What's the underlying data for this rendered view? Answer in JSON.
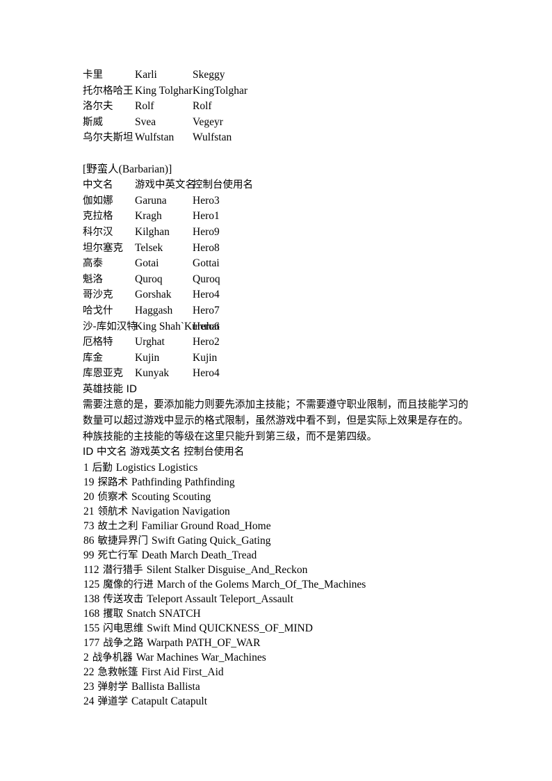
{
  "document": {
    "background_color": "#ffffff",
    "text_color": "#000000"
  },
  "viking_roster_tail": {
    "rows": [
      {
        "chinese": "卡里",
        "game_english": "Karli",
        "console_name": "Skeggy"
      },
      {
        "chinese": "托尔格哈王",
        "game_english": "King Tolghar",
        "console_name": "KingTolghar"
      },
      {
        "chinese": "洛尔夫",
        "game_english": "Rolf",
        "console_name": "Rolf"
      },
      {
        "chinese": "斯威",
        "game_english": "Svea",
        "console_name": "Vegeyr"
      },
      {
        "chinese": "乌尔夫斯坦",
        "game_english": "Wulfstan",
        "console_name": "Wulfstan"
      }
    ]
  },
  "barbarian_section": {
    "heading": "[野蛮人(Barbarian)]",
    "columns": {
      "chinese": "中文名",
      "game_english": "游戏中英文名",
      "console_name": "控制台使用名"
    },
    "rows": [
      {
        "chinese": "伽如娜",
        "game_english": "Garuna",
        "console_name": "Hero3"
      },
      {
        "chinese": "克拉格",
        "game_english": "Kragh",
        "console_name": "Hero1"
      },
      {
        "chinese": "科尔汉",
        "game_english": "Kilghan",
        "console_name": "Hero9"
      },
      {
        "chinese": "坦尔塞克",
        "game_english": "Telsek",
        "console_name": "Hero8"
      },
      {
        "chinese": "高泰",
        "game_english": "Gotai",
        "console_name": "Gottai"
      },
      {
        "chinese": "魁洛",
        "game_english": "Quroq",
        "console_name": "Quroq"
      },
      {
        "chinese": "哥沙克",
        "game_english": "Gorshak",
        "console_name": "Hero4"
      },
      {
        "chinese": "哈戈什",
        "game_english": "Haggash",
        "console_name": "Hero7"
      },
      {
        "chinese": "沙-库如汉特",
        "game_english": "King Shah`Kuruhat",
        "console_name": "Hero6"
      },
      {
        "chinese": "厄格特",
        "game_english": "Urghat",
        "console_name": "Hero2"
      },
      {
        "chinese": "库金",
        "game_english": "Kujin",
        "console_name": "Kujin"
      },
      {
        "chinese": "库恩亚克",
        "game_english": "Kunyak",
        "console_name": "Hero4"
      }
    ]
  },
  "skill_section": {
    "heading": "英雄技能 ID",
    "note": "需要注意的是，要添加能力则要先添加主技能；不需要遵守职业限制，而且技能学习的数量可以超过游戏中显示的格式限制，虽然游戏中看不到，但是实际上效果是存在的。种族技能的主技能的等级在这里只能升到第三级，而不是第四级。",
    "columns_line": "ID 中文名 游戏英文名 控制台使用名",
    "rows": [
      {
        "id": "1",
        "chinese": "后勤",
        "game_english": "Logistics",
        "console_name": "Logistics"
      },
      {
        "id": "19",
        "chinese": "探路术",
        "game_english": "Pathfinding",
        "console_name": "Pathfinding"
      },
      {
        "id": "20",
        "chinese": "侦察术",
        "game_english": "Scouting",
        "console_name": "Scouting"
      },
      {
        "id": "21",
        "chinese": "领航术",
        "game_english": "Navigation",
        "console_name": "Navigation"
      },
      {
        "id": "73",
        "chinese": "故土之利",
        "game_english": "Familiar Ground",
        "console_name": "Road_Home"
      },
      {
        "id": "86",
        "chinese": "敏捷异界门",
        "game_english": "Swift Gating",
        "console_name": "Quick_Gating"
      },
      {
        "id": "99",
        "chinese": "死亡行军",
        "game_english": "Death March",
        "console_name": "Death_Tread"
      },
      {
        "id": "112",
        "chinese": "潜行猎手",
        "game_english": "Silent Stalker",
        "console_name": "Disguise_And_Reckon"
      },
      {
        "id": "125",
        "chinese": "魔像的行进",
        "game_english": "March of the Golems",
        "console_name": "March_Of_The_Machines"
      },
      {
        "id": "138",
        "chinese": "传送攻击",
        "game_english": "Teleport Assault",
        "console_name": "Teleport_Assault"
      },
      {
        "id": "168",
        "chinese": "攫取",
        "game_english": "Snatch",
        "console_name": "SNATCH"
      },
      {
        "id": "155",
        "chinese": "闪电思维",
        "game_english": "Swift Mind",
        "console_name": "QUICKNESS_OF_MIND"
      },
      {
        "id": "177",
        "chinese": "战争之路",
        "game_english": "Warpath",
        "console_name": "PATH_OF_WAR"
      },
      {
        "id": "2",
        "chinese": "战争机器",
        "game_english": "War Machines",
        "console_name": "War_Machines"
      },
      {
        "id": "22",
        "chinese": "急救帐篷",
        "game_english": "First Aid",
        "console_name": "First_Aid"
      },
      {
        "id": "23",
        "chinese": "弹射学",
        "game_english": "Ballista",
        "console_name": "Ballista"
      },
      {
        "id": "24",
        "chinese": "弹道学",
        "game_english": "Catapult",
        "console_name": "Catapult"
      }
    ]
  }
}
